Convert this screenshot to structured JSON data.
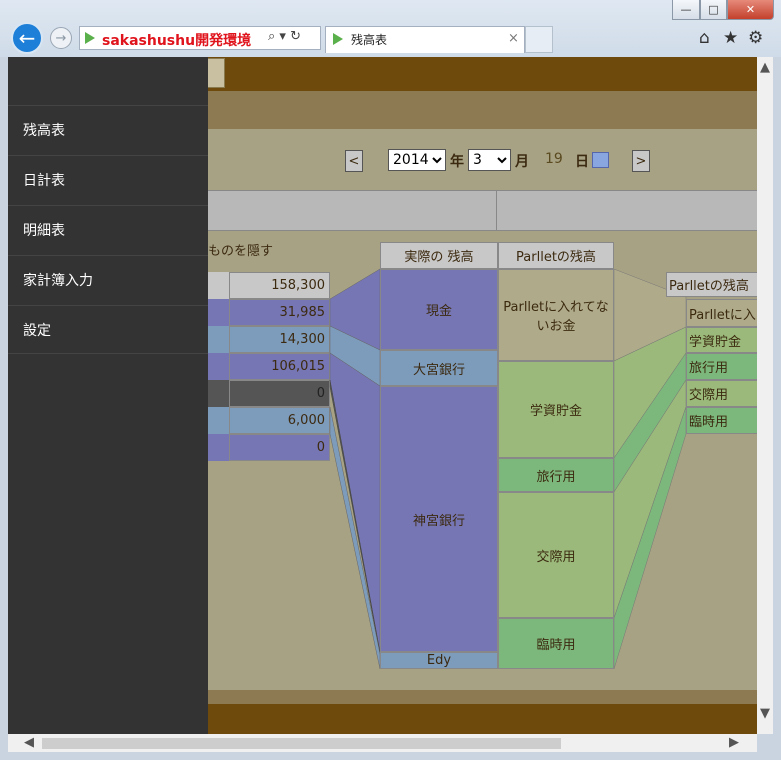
{
  "browser": {
    "address": "sakashushu開発環境",
    "tab_title": "残高表",
    "tab_close": "×",
    "address_icons": "⌕ ▾ ↻",
    "window_min": "—",
    "window_max": "□",
    "window_close": "✕"
  },
  "date_bar": {
    "prev": "<",
    "next": ">",
    "year": "2014",
    "year_label": "年",
    "month": "3",
    "month_label": "月",
    "day": "19",
    "day_label": "日"
  },
  "hide_label": "ものを隠す",
  "balances": [
    "158,300",
    "31,985",
    "14,300",
    "106,015",
    "0",
    "6,000",
    "0"
  ],
  "actual": {
    "header": "実際の 残高",
    "items": [
      "現金",
      "大宮銀行",
      "神宮銀行",
      "Edy"
    ]
  },
  "parllet": {
    "header": "Parlletの残高",
    "items": [
      "Parlletに入れてないお金",
      "学資貯金",
      "旅行用",
      "交際用",
      "臨時用"
    ]
  },
  "parllet2": {
    "header": "Parlletの残高",
    "items": [
      "Parlletに入",
      "学資貯金",
      "旅行用",
      "交際用",
      "臨時用"
    ]
  },
  "menu": {
    "items": [
      "残高表",
      "日計表",
      "明細表",
      "家計簿入力",
      "設定"
    ]
  },
  "colors": {
    "purple": "#7676b4",
    "steel": "#7d9bbb",
    "sage": "#9ab97a",
    "green": "#7cb87c",
    "beige": "#afab8a",
    "dark": "#555555",
    "drawer": "#333333"
  }
}
